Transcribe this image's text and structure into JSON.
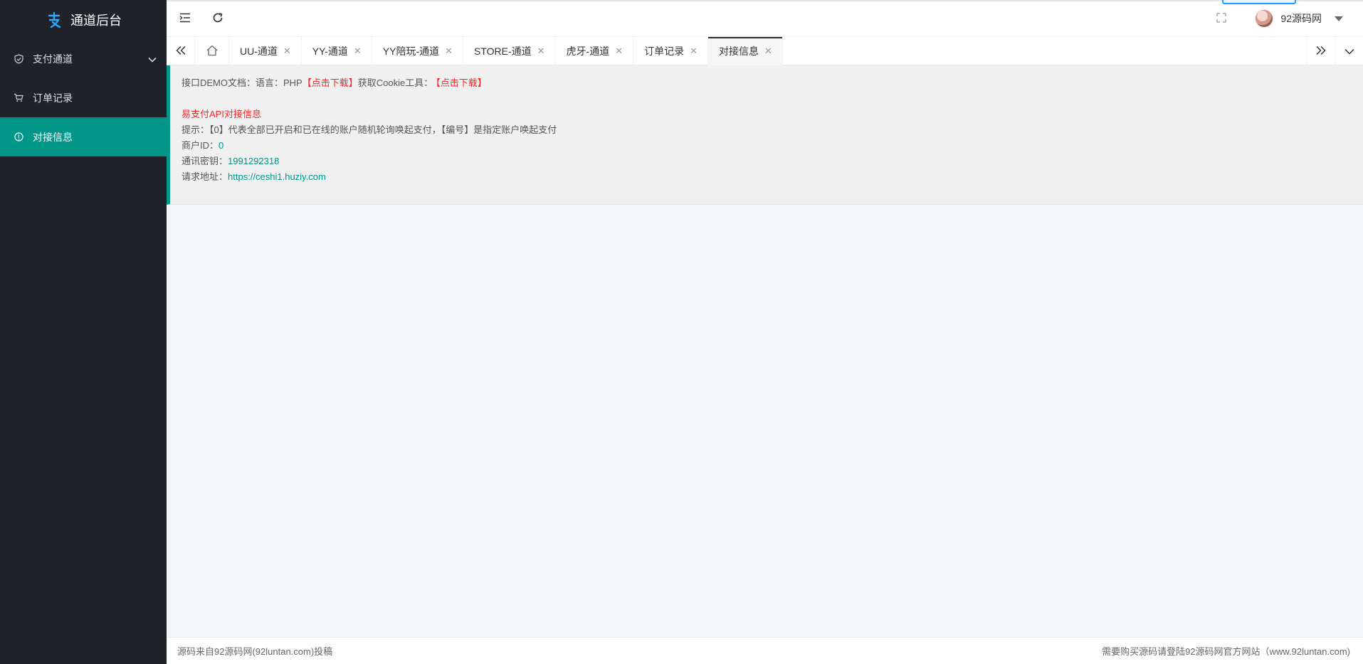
{
  "app": {
    "title": "通道后台"
  },
  "sidebar": {
    "items": [
      {
        "label": "支付通道",
        "icon": "shield-check-icon",
        "has_children": true
      },
      {
        "label": "订单记录",
        "icon": "cart-icon"
      },
      {
        "label": "对接信息",
        "icon": "info-icon",
        "active": true
      }
    ],
    "accent_color": "#009688",
    "background": "#20222a"
  },
  "header": {
    "username": "92源码网"
  },
  "tabs": [
    {
      "label": "UU-通道"
    },
    {
      "label": "YY-通道"
    },
    {
      "label": "YY陪玩-通道"
    },
    {
      "label": "STORE-通道"
    },
    {
      "label": "虎牙-通道"
    },
    {
      "label": "订单记录"
    },
    {
      "label": "对接信息",
      "active": true
    }
  ],
  "notice": {
    "demo_prefix": "接口DEMO文档：语言：PHP",
    "download_link_1": "【点击下载】",
    "cookie_prefix": "获取Cookie工具：",
    "download_link_2": "【点击下载】",
    "section_title": "易支付API对接信息",
    "hint": "提示：【0】代表全部已开启和已在线的账户随机轮询唤起支付，【编号】是指定账户唤起支付",
    "merchant_id_label": "商户ID：",
    "merchant_id_value": "0",
    "secret_label": "通讯密钥：",
    "secret_value": "1991292318",
    "request_url_label": "请求地址：",
    "request_url_value": "https://ceshi1.huziy.com"
  },
  "footer": {
    "left": "源码来自92源码网(92luntan.com)投稿",
    "right": "需要购买源码请登陆92源码网官方网站（www.92luntan.com)"
  }
}
